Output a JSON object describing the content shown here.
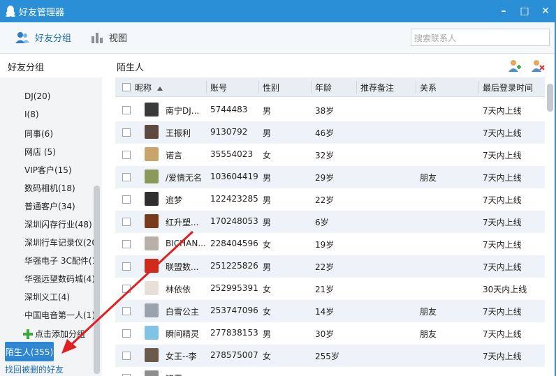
{
  "window": {
    "title": "好友管理器",
    "minimize": "–",
    "maximize": "□",
    "close": "✕"
  },
  "toolbar": {
    "groups_label": "好友分组",
    "view_label": "视图",
    "search_placeholder": "搜索联系人"
  },
  "sidebar": {
    "heading": "好友分组",
    "groups": [
      "DJ(20)",
      "I(8)",
      "同事(6)",
      "网店 (5)",
      "VIP客户(15)",
      "数码相机(18)",
      "普通客户(34)",
      "深圳闪存行业(48)",
      "深圳行车记录仪(20",
      "华强电子 3C配件(1",
      "华强远望数码城(4)",
      "深圳义工(4)",
      "中国电音第一人(1)"
    ],
    "add_group": "点击添加分组",
    "selected_group": "陌生人(355)",
    "recover_link": "找回被删的好友"
  },
  "main": {
    "heading": "陌生人",
    "columns": [
      "昵称",
      "账号",
      "性别",
      "年龄",
      "推荐备注",
      "关系",
      "最后登录时间"
    ],
    "rows": [
      {
        "nick": "南宁DJ...",
        "account": "5744483",
        "gender": "男",
        "age": "38岁",
        "remark": "",
        "relation": "",
        "last_login": "7天内上线",
        "avatar_color": "#3a3a3a"
      },
      {
        "nick": "王振利",
        "account": "9130792",
        "gender": "男",
        "age": "46岁",
        "remark": "",
        "relation": "",
        "last_login": "7天内上线",
        "avatar_color": "#5d4a3c"
      },
      {
        "nick": "诺言",
        "account": "35554023",
        "gender": "女",
        "age": "32岁",
        "remark": "",
        "relation": "",
        "last_login": "7天内上线",
        "avatar_color": "#c9a46a"
      },
      {
        "nick": "/爱情无名",
        "account": "103604419",
        "gender": "男",
        "age": "29岁",
        "remark": "",
        "relation": "朋友",
        "last_login": "7天内上线",
        "avatar_color": "#8a9a5b"
      },
      {
        "nick": "追梦",
        "account": "122423285",
        "gender": "男",
        "age": "22岁",
        "remark": "",
        "relation": "",
        "last_login": "7天内上线",
        "avatar_color": "#2f2f2f"
      },
      {
        "nick": "红升塑...",
        "account": "170248053",
        "gender": "男",
        "age": "6岁",
        "remark": "",
        "relation": "",
        "last_login": "7天内上线",
        "avatar_color": "#7a3b1c"
      },
      {
        "nick": "BICHAN...",
        "account": "228404596",
        "gender": "女",
        "age": "19岁",
        "remark": "",
        "relation": "",
        "last_login": "7天内上线",
        "avatar_color": "#b8b0a8"
      },
      {
        "nick": "联盟数...",
        "account": "251225826",
        "gender": "男",
        "age": "22岁",
        "remark": "",
        "relation": "",
        "last_login": "7天内上线",
        "avatar_color": "#d02a1a"
      },
      {
        "nick": "林依依",
        "account": "252995391",
        "gender": "女",
        "age": "21岁",
        "remark": "",
        "relation": "",
        "last_login": "30天内上线",
        "avatar_color": "#e8e0d8"
      },
      {
        "nick": "白雪公主",
        "account": "253747096",
        "gender": "女",
        "age": "14岁",
        "remark": "",
        "relation": "朋友",
        "last_login": "7天内上线",
        "avatar_color": "#9aa3ad"
      },
      {
        "nick": "瞬间精灵",
        "account": "277838153",
        "gender": "男",
        "age": "30岁",
        "remark": "",
        "relation": "朋友",
        "last_login": "7天内上线",
        "avatar_color": "#7fc3e8"
      },
      {
        "nick": "女王--李",
        "account": "278575007",
        "gender": "女",
        "age": "255岁",
        "remark": "",
        "relation": "",
        "last_login": "7天内上线",
        "avatar_color": "#6b5a4a"
      },
      {
        "nick": "晓霞...",
        "account": "",
        "gender": "",
        "age": "",
        "remark": "",
        "relation": "",
        "last_login": "",
        "avatar_color": "#8f8f8f"
      }
    ]
  },
  "colors": {
    "titlebar": "#2b8fd7",
    "accent": "#2f86d3",
    "annotation_arrow": "#e02020"
  }
}
